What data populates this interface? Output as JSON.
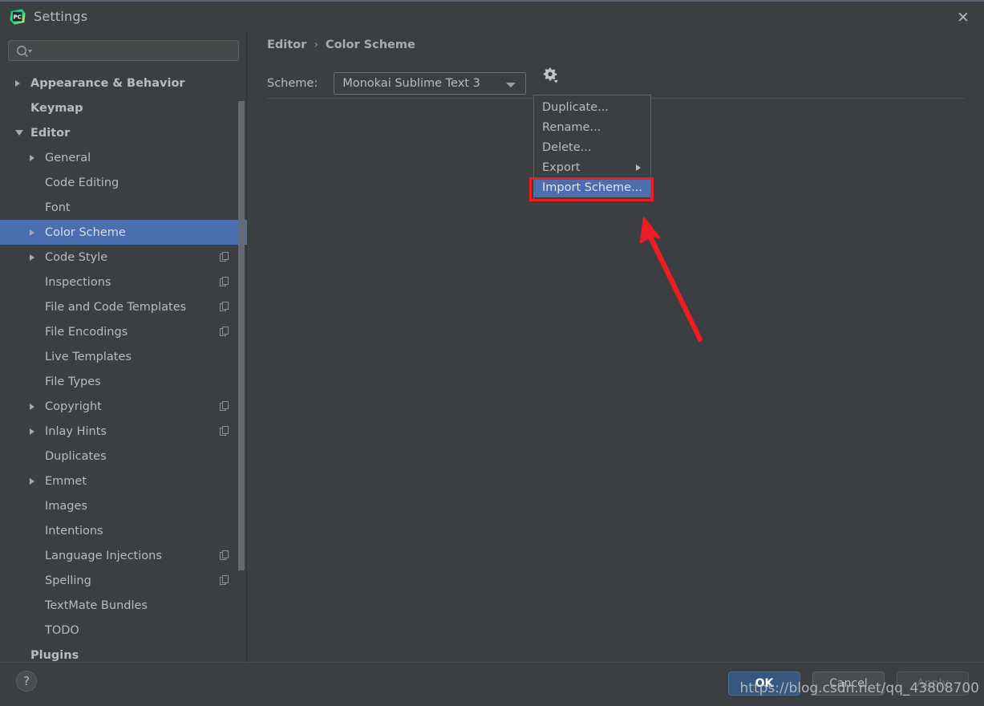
{
  "window": {
    "title": "Settings",
    "logo_icon": "pycharm-logo-icon",
    "close_icon": "close-icon"
  },
  "sidebar": {
    "search": {
      "placeholder": "",
      "value": "",
      "icon": "search-icon"
    },
    "items": [
      {
        "label": "Appearance & Behavior",
        "indent": 38,
        "arrow": "collapsed",
        "bold": true,
        "badge": false,
        "selected": false
      },
      {
        "label": "Keymap",
        "indent": 38,
        "arrow": "none",
        "bold": true,
        "badge": false,
        "selected": false
      },
      {
        "label": "Editor",
        "indent": 38,
        "arrow": "expanded",
        "bold": true,
        "badge": false,
        "selected": false
      },
      {
        "label": "General",
        "indent": 56,
        "arrow": "collapsed",
        "bold": false,
        "badge": false,
        "selected": false
      },
      {
        "label": "Code Editing",
        "indent": 56,
        "arrow": "none",
        "bold": false,
        "badge": false,
        "selected": false
      },
      {
        "label": "Font",
        "indent": 56,
        "arrow": "none",
        "bold": false,
        "badge": false,
        "selected": false
      },
      {
        "label": "Color Scheme",
        "indent": 56,
        "arrow": "collapsed",
        "bold": false,
        "badge": false,
        "selected": true
      },
      {
        "label": "Code Style",
        "indent": 56,
        "arrow": "collapsed",
        "bold": false,
        "badge": true,
        "selected": false
      },
      {
        "label": "Inspections",
        "indent": 56,
        "arrow": "none",
        "bold": false,
        "badge": true,
        "selected": false
      },
      {
        "label": "File and Code Templates",
        "indent": 56,
        "arrow": "none",
        "bold": false,
        "badge": true,
        "selected": false
      },
      {
        "label": "File Encodings",
        "indent": 56,
        "arrow": "none",
        "bold": false,
        "badge": true,
        "selected": false
      },
      {
        "label": "Live Templates",
        "indent": 56,
        "arrow": "none",
        "bold": false,
        "badge": false,
        "selected": false
      },
      {
        "label": "File Types",
        "indent": 56,
        "arrow": "none",
        "bold": false,
        "badge": false,
        "selected": false
      },
      {
        "label": "Copyright",
        "indent": 56,
        "arrow": "collapsed",
        "bold": false,
        "badge": true,
        "selected": false
      },
      {
        "label": "Inlay Hints",
        "indent": 56,
        "arrow": "collapsed",
        "bold": false,
        "badge": true,
        "selected": false
      },
      {
        "label": "Duplicates",
        "indent": 56,
        "arrow": "none",
        "bold": false,
        "badge": false,
        "selected": false
      },
      {
        "label": "Emmet",
        "indent": 56,
        "arrow": "collapsed",
        "bold": false,
        "badge": false,
        "selected": false
      },
      {
        "label": "Images",
        "indent": 56,
        "arrow": "none",
        "bold": false,
        "badge": false,
        "selected": false
      },
      {
        "label": "Intentions",
        "indent": 56,
        "arrow": "none",
        "bold": false,
        "badge": false,
        "selected": false
      },
      {
        "label": "Language Injections",
        "indent": 56,
        "arrow": "none",
        "bold": false,
        "badge": true,
        "selected": false
      },
      {
        "label": "Spelling",
        "indent": 56,
        "arrow": "none",
        "bold": false,
        "badge": true,
        "selected": false
      },
      {
        "label": "TextMate Bundles",
        "indent": 56,
        "arrow": "none",
        "bold": false,
        "badge": false,
        "selected": false
      },
      {
        "label": "TODO",
        "indent": 56,
        "arrow": "none",
        "bold": false,
        "badge": false,
        "selected": false
      },
      {
        "label": "Plugins",
        "indent": 38,
        "arrow": "none",
        "bold": true,
        "badge": false,
        "selected": false
      }
    ]
  },
  "main": {
    "breadcrumb": {
      "parent": "Editor",
      "separator": "›",
      "current": "Color Scheme"
    },
    "scheme": {
      "label": "Scheme:",
      "value": "Monokai Sublime Text 3",
      "gear_icon": "gear-icon",
      "caret_icon": "chevron-down-icon"
    }
  },
  "menu": {
    "items": [
      {
        "label": "Duplicate...",
        "highlight": false,
        "submenu": false
      },
      {
        "label": "Rename...",
        "highlight": false,
        "submenu": false
      },
      {
        "label": "Delete...",
        "highlight": false,
        "submenu": false
      },
      {
        "label": "Export",
        "highlight": false,
        "submenu": true
      },
      {
        "label": "Import Scheme...",
        "highlight": true,
        "submenu": false
      }
    ]
  },
  "footer": {
    "help_label": "?",
    "ok_label": "OK",
    "cancel_label": "Cancel",
    "apply_label": "Apply"
  },
  "annotations": {
    "highlight_color": "#ee1c24",
    "watermark": "https://blog.csdn.net/qq_43808700"
  },
  "colors": {
    "window_bg": "#3c3f41",
    "selection_blue": "#4b6eaf",
    "ok_button_blue": "#365880",
    "text": "#bbbbbb"
  }
}
